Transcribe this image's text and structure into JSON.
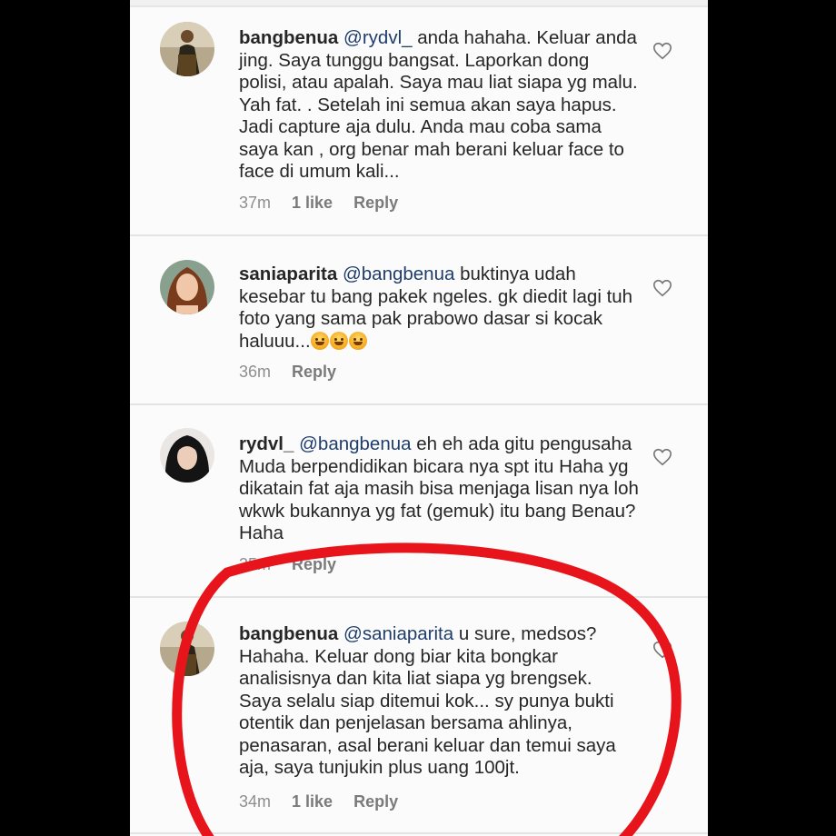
{
  "annotation": {
    "color": "#e8141b"
  },
  "comments": [
    {
      "avatar_icon": "avatar-bangbenua",
      "username": "bangbenua",
      "mention": "@rydvl_",
      "text": " anda hahaha. Keluar anda jing. Saya tunggu bangsat. Laporkan dong polisi, atau apalah. Saya mau liat siapa yg malu. Yah fat. . Setelah ini semua akan saya hapus. Jadi capture aja dulu. Anda mau coba sama saya kan , org benar mah berani keluar face to face di umum kali...",
      "time": "37m",
      "likes": "1 like",
      "reply": "Reply"
    },
    {
      "avatar_icon": "avatar-saniaparita",
      "username": "saniaparita",
      "mention": "@bangbenua",
      "text": "  buktinya udah kesebar tu bang pakek ngeles. gk diedit lagi tuh foto yang sama pak prabowo dasar si kocak haluuu...",
      "emoji": [
        "smiley-emoji",
        "smiley-emoji",
        "smiley-emoji"
      ],
      "time": "36m",
      "reply": "Reply"
    },
    {
      "avatar_icon": "avatar-rydvl",
      "username": "rydvl_",
      "mention": "@bangbenua",
      "text": " eh eh ada gitu pengusaha Muda berpendidikan bicara nya spt itu Haha yg dikatain fat aja masih bisa menjaga lisan nya loh wkwk bukannya yg fat (gemuk) itu bang Benau? Haha",
      "time": "35m",
      "reply": "Reply"
    },
    {
      "avatar_icon": "avatar-bangbenua",
      "username": "bangbenua",
      "mention": "@saniaparita",
      "text": " u sure, medsos? Hahaha. Keluar dong biar kita bongkar analisisnya dan kita liat siapa yg brengsek. Saya selalu siap ditemui kok... sy punya bukti otentik dan penjelasan bersama ahlinya, penasaran, asal berani keluar dan temui saya aja, saya tunjukin plus uang 100jt.",
      "time": "34m",
      "likes": "1 like",
      "reply": "Reply"
    }
  ]
}
